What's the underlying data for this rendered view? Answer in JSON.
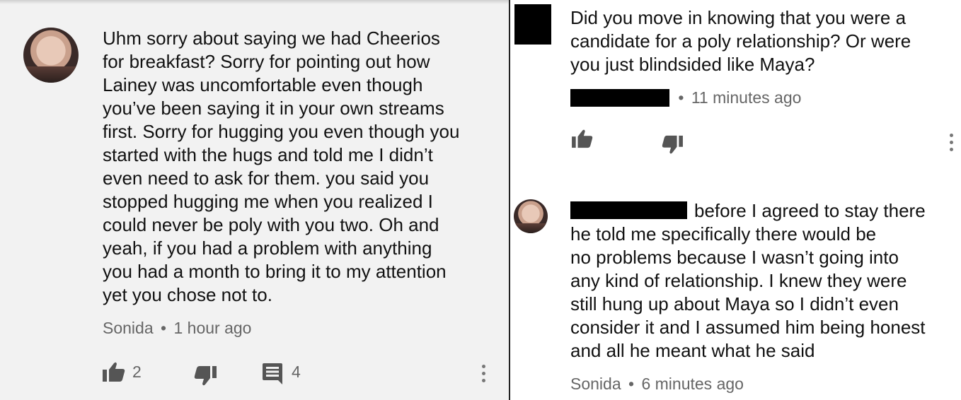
{
  "left_comment": {
    "text": "Uhm sorry about saying we had Cheerios\nfor breakfast? Sorry for pointing out how\nLainey was uncomfortable even though\nyou’ve been saying it in your own streams\nfirst. Sorry for hugging you even though you\nstarted with the hugs and told me I didn’t\neven need to ask for them. you said you\nstopped hugging me when you realized I\ncould never be poly with you two. Oh and\nyeah, if you had a problem with anything\nyou had a month to bring it to my attention\nyet you chose not to.",
    "author": "Sonida",
    "separator": "•",
    "time": "1 hour ago",
    "like_count": "2",
    "reply_count": "4",
    "icons": {
      "like": "thumbs-up-icon",
      "dislike": "thumbs-down-icon",
      "reply": "comment-icon",
      "more": "more-vert-icon"
    }
  },
  "right_comment_top": {
    "text": "Did you move in knowing that you were a\ncandidate for a poly relationship? Or were\nyou just blindsided like Maya?",
    "separator": "•",
    "time": "11 minutes ago"
  },
  "right_comment_bottom": {
    "text": "before I agreed to stay there\nhe told me specifically there would be\nno problems because I wasn’t going into\nany kind of relationship. I knew they were\nstill hung up about Maya so I didn’t even\nconsider it and I assumed him being honest\nand all he meant what he said",
    "author": "Sonida",
    "separator": "•",
    "time": "6 minutes ago"
  },
  "colors": {
    "left_bg": "#f2f2f2",
    "right_bg": "#ffffff",
    "icon": "#555555",
    "meta": "#666666"
  }
}
